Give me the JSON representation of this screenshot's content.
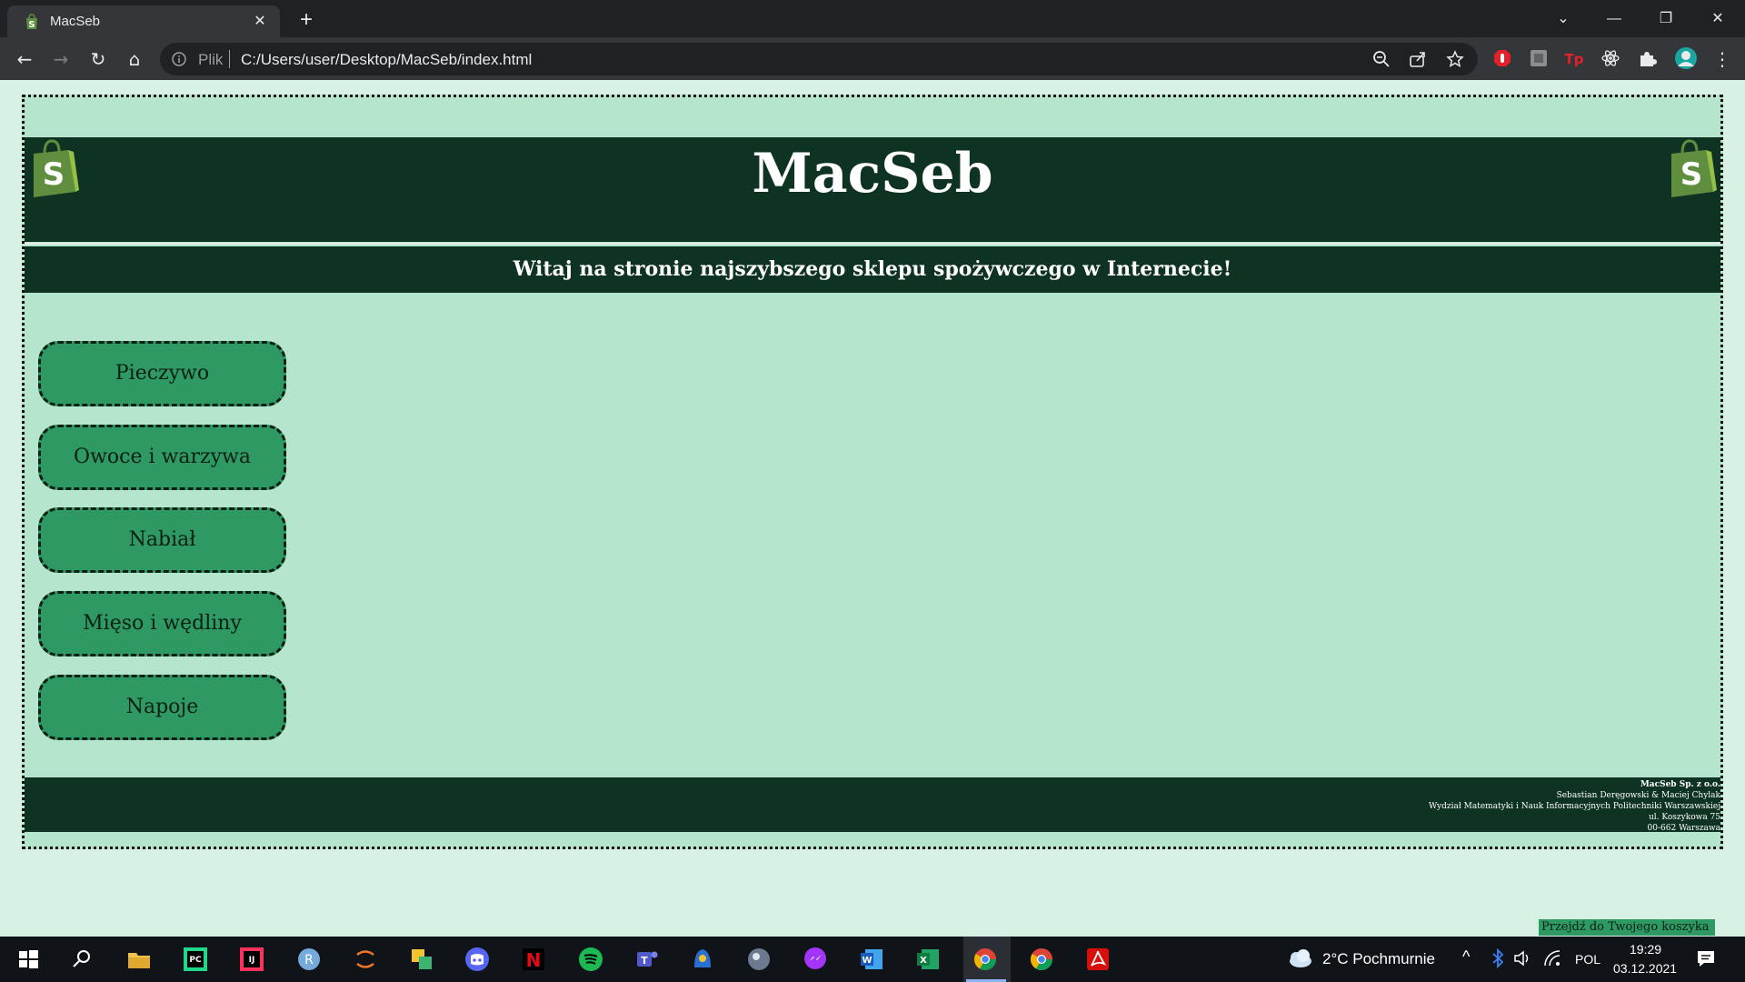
{
  "browser": {
    "tab_title": "MacSeb",
    "tab_close": "✕",
    "new_tab": "+",
    "omnibox_scheme_label": "Plik",
    "omnibox_url": "C:/Users/user/Desktop/MacSeb/index.html",
    "window_controls": {
      "tab_search": "⌄",
      "minimize": "—",
      "restore": "❐",
      "close": "✕"
    },
    "nav": {
      "back": "←",
      "forward": "→",
      "reload": "↻",
      "home": "⌂"
    },
    "menu": "⋮"
  },
  "page": {
    "site_title": "MacSeb",
    "welcome": "Witaj na stronie najszybszego sklepu spożywczego w Internecie!",
    "categories": [
      {
        "label": "Pieczywo"
      },
      {
        "label": "Owoce i warzywa"
      },
      {
        "label": "Nabiał"
      },
      {
        "label": "Mięso i wędliny"
      },
      {
        "label": "Napoje"
      }
    ],
    "footer": {
      "company": "MacSeb Sp. z o.o.",
      "authors": "Sebastian Deręgowski & Maciej Chylak",
      "faculty": "Wydział Matematyki i Nauk Informacyjnych Politechniki Warszawskiej",
      "street": "ul. Koszykowa 75",
      "city": "00-662 Warszawa"
    },
    "cart_link": "Przejdź do Twojego koszyka"
  },
  "taskbar": {
    "weather": "2°C  Pochmurnie",
    "language": "POL",
    "time": "19:29",
    "date": "03.12.2021"
  },
  "colors": {
    "header_bg": "#0e3323",
    "content_bg": "#b5e5cc",
    "button_bg": "#2e9963",
    "page_bg": "#d6f0e3"
  }
}
